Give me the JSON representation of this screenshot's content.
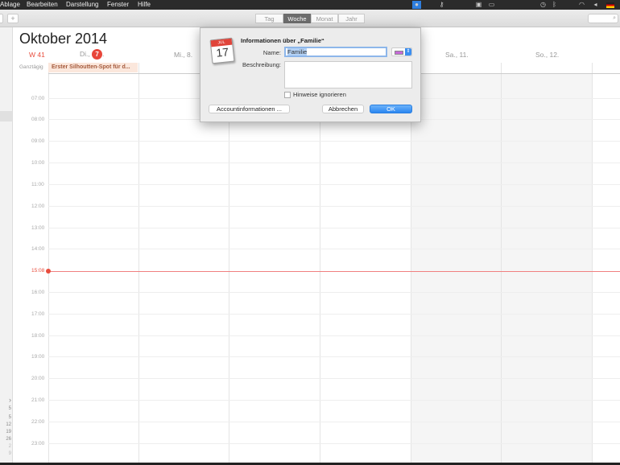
{
  "menubar": {
    "items": [
      "Ablage",
      "Bearbeiten",
      "Darstellung",
      "Fenster",
      "Hilfe"
    ]
  },
  "toolbar": {
    "add": "+",
    "views": [
      "Tag",
      "Woche",
      "Monat",
      "Jahr"
    ],
    "active_view": "Woche",
    "search_icon": "⌕"
  },
  "calendar": {
    "title": "Oktober 2014",
    "week": "W 41",
    "days": [
      {
        "label": "Di.,",
        "date": "7",
        "suffix": "."
      },
      {
        "label": "Mi., 8."
      },
      {
        "label": "Sa., 11."
      },
      {
        "label": "So., 12."
      }
    ],
    "allday_label": "Ganztägig",
    "allday_event": "Erster Silhoutten-Spot für d...",
    "hours": [
      "07:00",
      "08:00",
      "09:00",
      "10:00",
      "11:00",
      "12:00",
      "13:00",
      "14:00",
      "16:00",
      "17:00",
      "18:00",
      "19:00",
      "20:00",
      "21:00",
      "22:00",
      "23:00"
    ],
    "now": "15:08"
  },
  "sidebar": {
    "chevron": "›",
    "mini_dates": [
      "5",
      "5",
      "12",
      "19",
      "26",
      "2",
      "9"
    ]
  },
  "dialog": {
    "icon_month": "JUL",
    "icon_day": "17",
    "title": "Informationen über „Familie“",
    "name_label": "Name:",
    "name_value": "Familie",
    "color": "#c66ad8",
    "desc_label": "Beschreibung:",
    "checkbox_label": "Hinweise ignorieren",
    "account_button": "Accountinformationen ...",
    "cancel_button": "Abbrechen",
    "ok_button": "OK"
  }
}
